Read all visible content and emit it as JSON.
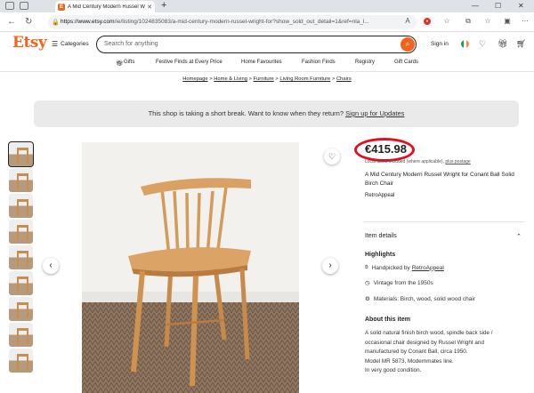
{
  "browser": {
    "tab_title": "A Mid Century Modern Russel Wright",
    "favicon_letter": "E",
    "url_host": "https://www.etsy.com",
    "url_path": "/ie/listing/1024835083/a-mid-century-modern-russel-wright-for?show_sold_out_detail=1&ref=nla_l..."
  },
  "header": {
    "logo": "Etsy",
    "categories_label": "Categories",
    "search_placeholder": "Search for anything",
    "signin_label": "Sign in"
  },
  "nav": {
    "items": [
      "Gifts",
      "Festive Finds at Every Price",
      "Home Favourites",
      "Fashion Finds",
      "Registry",
      "Gift Cards"
    ]
  },
  "breadcrumb": [
    "Homepage",
    "Home & Living",
    "Furniture",
    "Living Room Furniture",
    "Chairs"
  ],
  "notice": {
    "text": "This shop is taking a short break. Want to know when they return?",
    "link": "Sign up for Updates"
  },
  "product": {
    "price": "€415.98",
    "tax_note": "Local taxes included (where applicable),",
    "tax_link": "plus postage",
    "title": "A Mid Century Modern Russel Wright for Conant Ball Solid Birch Chair",
    "shop_name": "RetroAppeal",
    "item_details_label": "Item details",
    "highlights_label": "Highlights",
    "handpicked_prefix": "Handpicked by",
    "handpicked_shop": "RetroAppeal",
    "vintage": "Vintage from the 1950s",
    "materials": "Materials: Birch, wood, solid wood chair",
    "about_label": "About this item",
    "desc": [
      "A solid natural finish birch wood, spindle back side /",
      "occasional chair designed by Russel Wright and",
      "manufactured by Conant Ball, circa 1950.",
      "Model MR 5873, Modernmates line.",
      "In very good condition."
    ]
  },
  "colors": {
    "brand": "#f1641e",
    "highlight_oval": "#e01020"
  }
}
